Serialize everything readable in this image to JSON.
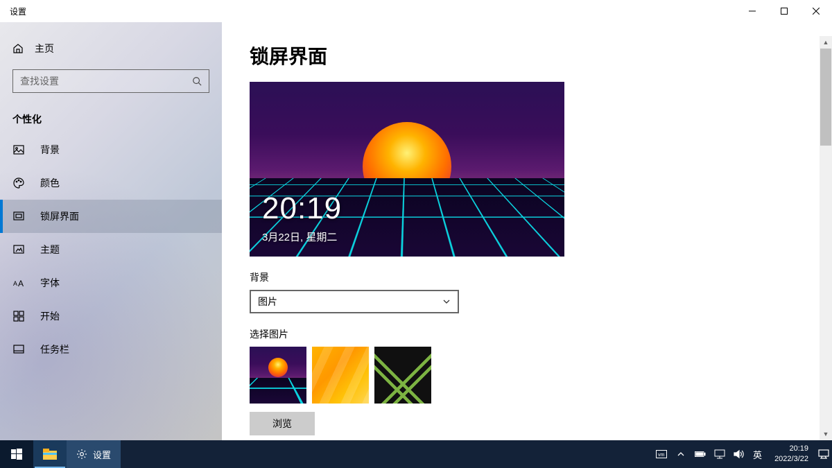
{
  "window": {
    "title": "设置"
  },
  "sidebar": {
    "home_label": "主页",
    "search_placeholder": "查找设置",
    "section_label": "个性化",
    "items": [
      {
        "label": "背景"
      },
      {
        "label": "颜色"
      },
      {
        "label": "锁屏界面"
      },
      {
        "label": "主题"
      },
      {
        "label": "字体"
      },
      {
        "label": "开始"
      },
      {
        "label": "任务栏"
      }
    ]
  },
  "content": {
    "page_title": "锁屏界面",
    "preview_time": "20:19",
    "preview_date": "3月22日, 星期二",
    "bg_section_label": "背景",
    "bg_dropdown_value": "图片",
    "choose_image_label": "选择图片",
    "browse_label": "浏览"
  },
  "taskbar": {
    "settings_label": "设置",
    "ime_label": "英",
    "time": "20:19",
    "date": "2022/3/22"
  }
}
